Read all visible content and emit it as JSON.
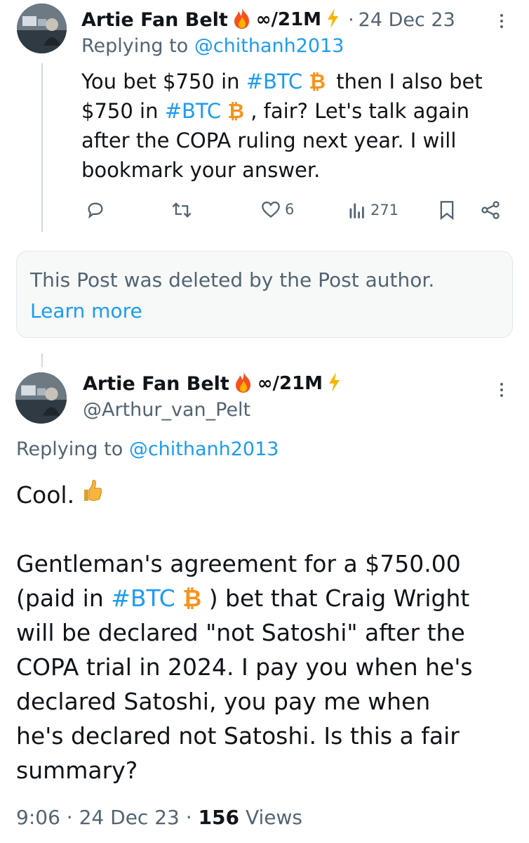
{
  "reply_tweet": {
    "display_name": "Artie Fan Belt",
    "name_suffix": "∞/21M",
    "dot_separator": "·",
    "date": "24 Dec 23",
    "replying_prefix": "Replying to",
    "replying_handle": "@chithanh2013",
    "text_p1": "You bet $750 in ",
    "hashtag": "#BTC",
    "btc_symbol": "₿",
    "text_p2": " then I also bet",
    "text_p3": "$750 in ",
    "text_p4": " , fair? Let's talk again",
    "text_p5": "after the COPA ruling next year. I will",
    "text_p6": "bookmark your answer.",
    "likes": "6",
    "views": "271"
  },
  "deleted_notice": {
    "text": "This Post was deleted by the Post author.",
    "link": "Learn more"
  },
  "main_tweet": {
    "display_name": "Artie Fan Belt",
    "name_suffix": "∞/21M",
    "handle": "@Arthur_van_Pelt",
    "replying_prefix": "Replying to",
    "replying_handle": "@chithanh2013",
    "line_cool": "Cool.",
    "l1": "Gentleman's agreement for a $750.00",
    "l2_a": "(paid in ",
    "l2_hashtag": "#BTC",
    "l2_btc": "₿",
    "l2_b": " ) bet that Craig Wright",
    "l3": "will be declared \"not Satoshi\" after the",
    "l4": "COPA trial in 2024. I pay you when he's",
    "l5": "declared Satoshi, you pay me when",
    "l6": "he's declared not Satoshi. Is this a fair",
    "l7": "summary?",
    "time": "9:06",
    "sep1": "·",
    "date": "24 Dec 23",
    "sep2": "·",
    "views_count": "156",
    "views_label": "Views"
  },
  "colors": {
    "link": "#1d9bf0",
    "secondary_text": "#536471",
    "fire": "#f4511e",
    "bolt": "#f5b400",
    "btc": "#f7931a",
    "thumb": "#f4b63d"
  },
  "icons": [
    "fire-icon",
    "bolt-icon",
    "bitcoin-icon",
    "more-icon",
    "reply-icon",
    "retweet-icon",
    "like-icon",
    "views-icon",
    "bookmark-icon",
    "share-icon",
    "thumbs-up-icon"
  ]
}
